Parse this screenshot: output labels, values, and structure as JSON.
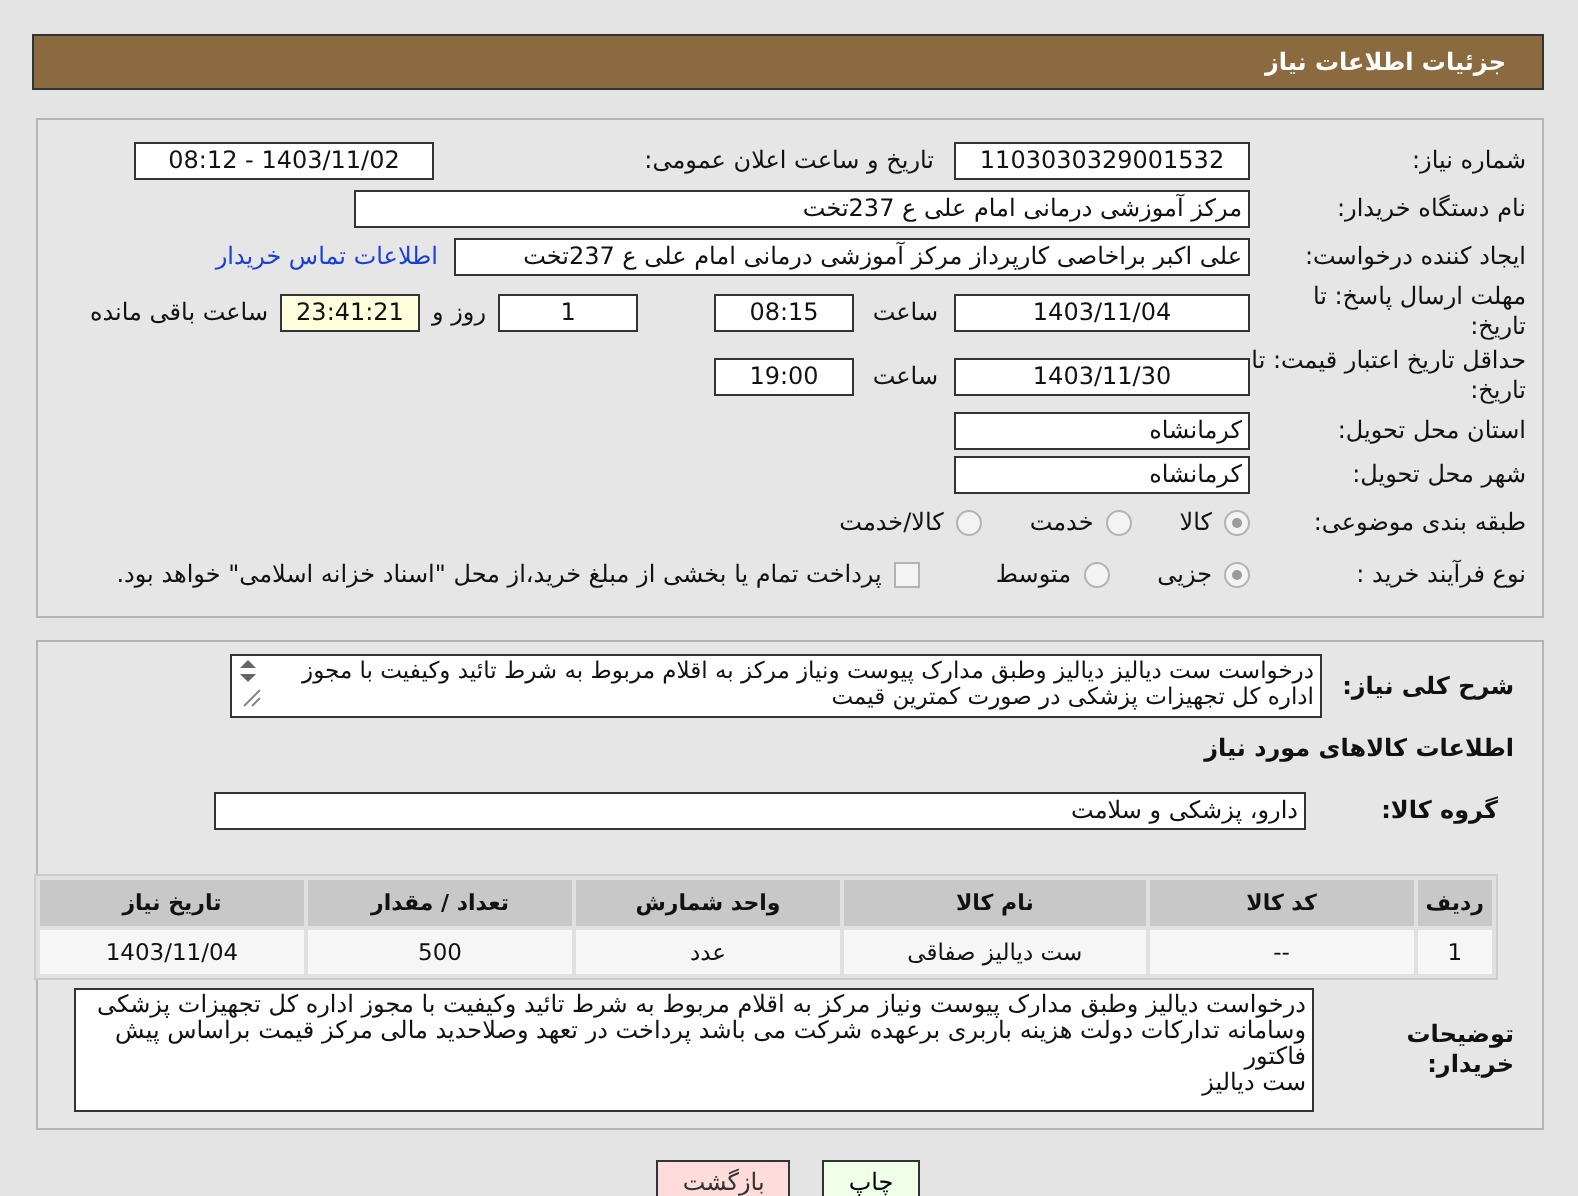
{
  "header": {
    "title": "جزئیات اطلاعات نیاز"
  },
  "details": {
    "need_number": {
      "label": "شماره نیاز:",
      "value": "1103030329001532"
    },
    "announce": {
      "label": "تاریخ و ساعت اعلان عمومی:",
      "value": "1403/11/02 - 08:12"
    },
    "buyer": {
      "label": "نام دستگاه خریدار:",
      "value": "مرکز آموزشی درمانی امام علی ع 237تخت"
    },
    "creator": {
      "label": "ایجاد کننده درخواست:",
      "value": "علی اکبر براخاصی کارپرداز  مرکز آموزشی درمانی امام علی ع 237تخت",
      "link": "اطلاعات تماس خریدار"
    },
    "deadline": {
      "label": "مهلت ارسال پاسخ: تا تاریخ:",
      "date": "1403/11/04",
      "time_label": "ساعت",
      "time": "08:15",
      "days": "1",
      "days_label": "روز و",
      "remaining": "23:41:21",
      "remaining_label": "ساعت باقی مانده"
    },
    "validity": {
      "label": "حداقل تاریخ اعتبار قیمت: تا تاریخ:",
      "date": "1403/11/30",
      "time_label": "ساعت",
      "time": "19:00"
    },
    "province": {
      "label": "استان محل تحویل:",
      "value": "کرمانشاه"
    },
    "city": {
      "label": "شهر محل تحویل:",
      "value": "کرمانشاه"
    },
    "category": {
      "label": "طبقه بندی موضوعی:",
      "options": [
        {
          "label": "کالا",
          "selected": true
        },
        {
          "label": "خدمت",
          "selected": false
        },
        {
          "label": "کالا/خدمت",
          "selected": false
        }
      ]
    },
    "process": {
      "label": "نوع فرآیند خرید :",
      "options": [
        {
          "label": "جزیی",
          "selected": true
        },
        {
          "label": "متوسط",
          "selected": false
        }
      ],
      "payment": {
        "checked": false,
        "text": "پرداخت تمام یا بخشی از مبلغ خرید،از محل \"اسناد خزانه اسلامی\" خواهد بود."
      }
    }
  },
  "need": {
    "description_label": "شرح کلی نیاز:",
    "description": "درخواست ست دیالیز دیالیز وطبق مدارک پیوست ونیاز مرکز به اقلام مربوط به شرط تائید وکیفیت با مجوز اداره کل تجهیزات پزشکی در صورت کمترین قیمت",
    "goods_heading": "اطلاعات کالاهای مورد نیاز",
    "group_label": "گروه کالا:",
    "group": "دارو، پزشکی و سلامت",
    "table": {
      "columns": [
        "ردیف",
        "کد کالا",
        "نام کالا",
        "واحد شمارش",
        "تعداد / مقدار",
        "تاریخ نیاز"
      ],
      "rows": [
        [
          "1",
          "--",
          "ست دیالیز صفاقی",
          "عدد",
          "500",
          "1403/11/04"
        ]
      ]
    },
    "notes_label": "توضیحات خریدار:",
    "notes": [
      "درخواست دیالیز وطبق مدارک پیوست ونیاز مرکز به اقلام مربوط به شرط تائید وکیفیت با مجوز اداره کل تجهیزات پزشکی وسامانه تدارکات دولت  هزینه باربری برعهده شرکت می باشد پرداخت در تعهد وصلاحدید مالی مرکز قیمت براساس پیش فاکتور",
      "ست دیالیز"
    ]
  },
  "buttons": [
    {
      "kind": "print",
      "label": "چاپ"
    },
    {
      "kind": "back",
      "label": "بازگشت"
    }
  ]
}
